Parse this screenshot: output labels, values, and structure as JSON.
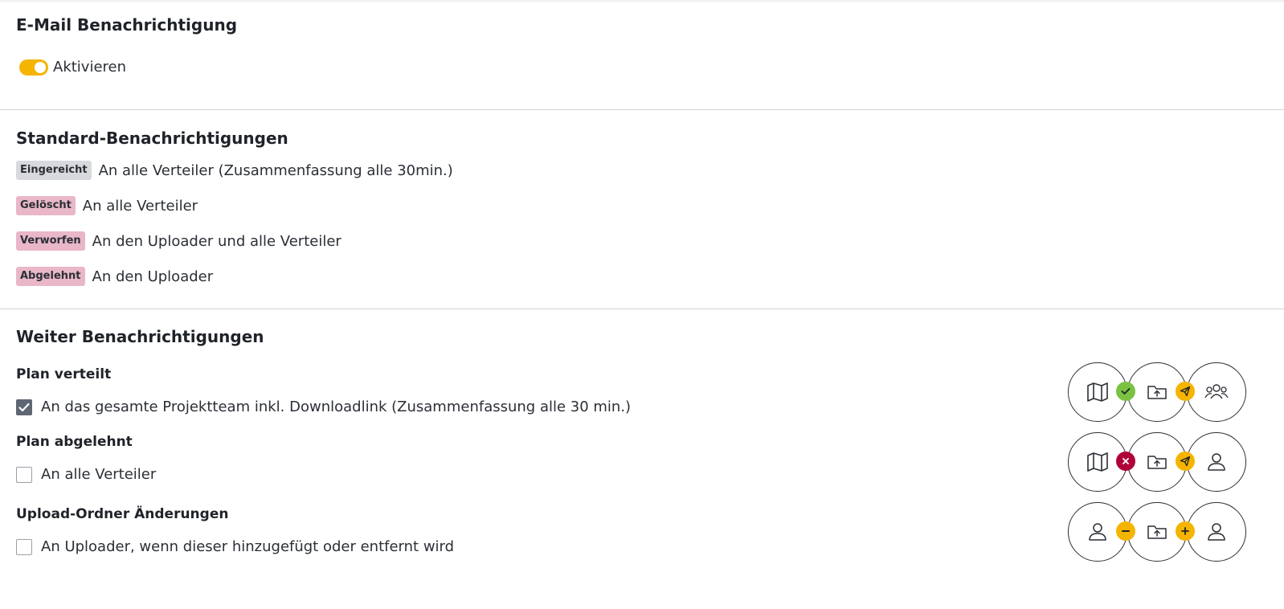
{
  "email_section": {
    "title": "E-Mail Benachrichtigung",
    "toggle_label": "Aktivieren",
    "toggle_on": true
  },
  "standard_section": {
    "title": "Standard-Benachrichtigungen",
    "rows": [
      {
        "badge": "Eingereicht",
        "text": "An alle Verteiler (Zusammenfassung alle 30min.)"
      },
      {
        "badge": "Gelöscht",
        "text": "An alle Verteiler"
      },
      {
        "badge": "Verworfen",
        "text": "An den Uploader und alle Verteiler"
      },
      {
        "badge": "Abgelehnt",
        "text": "An den Uploader"
      }
    ]
  },
  "further_section": {
    "title": "Weiter Benachrichtigungen",
    "items": [
      {
        "heading": "Plan verteilt",
        "label": "An das gesamte Projektteam inkl. Downloadlink (Zusammenfassung alle 30 min.)",
        "checked": true
      },
      {
        "heading": "Plan abgelehnt",
        "label": "An alle Verteiler",
        "checked": false
      },
      {
        "heading": "Upload-Ordner Änderungen",
        "label": "An Uploader, wenn dieser hinzugefügt oder entfernt wird",
        "checked": false
      }
    ]
  },
  "flows": [
    {
      "icons": [
        "map-icon",
        "folder-upload-icon",
        "team-icon"
      ],
      "dots": [
        "check-icon",
        "send-icon"
      ],
      "dot_colors": [
        "#7cc242",
        "#f5b400"
      ]
    },
    {
      "icons": [
        "map-icon",
        "folder-upload-icon",
        "user-icon"
      ],
      "dots": [
        "x-icon",
        "send-icon"
      ],
      "dot_colors": [
        "#b0003a",
        "#f5b400"
      ]
    },
    {
      "icons": [
        "user-icon",
        "folder-upload-icon",
        "user-icon"
      ],
      "dots": [
        "minus-icon",
        "plus-icon"
      ],
      "dot_colors": [
        "#f5b400",
        "#f5b400"
      ]
    }
  ],
  "colors": {
    "accent": "#f5b400",
    "badge_grey": "#d7d9dc",
    "badge_pink": "#e9b7c8",
    "checkbox_checked": "#5f6673"
  }
}
